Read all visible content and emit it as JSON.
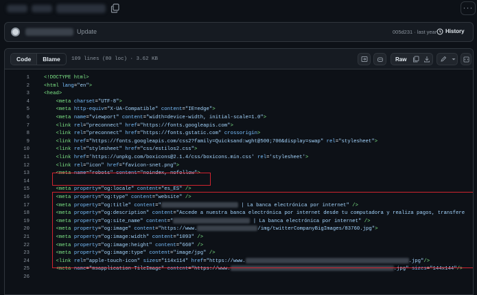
{
  "commit": {
    "message": "Update",
    "meta": "005d231 · last year",
    "history_label": "History"
  },
  "file": {
    "tab_code": "Code",
    "tab_blame": "Blame",
    "info": "109 lines (80 loc) · 3.62 KB",
    "raw_label": "Raw"
  },
  "lines": [
    {
      "n": "1",
      "html": "<span class='tg'>&lt;!DOCTYPE html&gt;</span>"
    },
    {
      "n": "2",
      "html": "<span class='tg'>&lt;html</span> <span class='at'>lang</span>=<span class='st'>\"en\"</span><span class='tg'>&gt;</span>"
    },
    {
      "n": "3",
      "html": "<span class='tg'>&lt;head&gt;</span>"
    },
    {
      "n": "4",
      "html": "    <span class='tg'>&lt;meta</span> <span class='at'>charset</span>=<span class='st'>\"UTF-8\"</span><span class='tg'>&gt;</span>"
    },
    {
      "n": "5",
      "html": "    <span class='tg'>&lt;meta</span> <span class='at'>http-equiv</span>=<span class='st'>\"X-UA-Compatible\"</span> <span class='at'>content</span>=<span class='st'>\"IE=edge\"</span><span class='tg'>&gt;</span>"
    },
    {
      "n": "6",
      "html": "    <span class='tg'>&lt;meta</span> <span class='at'>name</span>=<span class='st'>\"viewport\"</span> <span class='at'>content</span>=<span class='st'>\"width=device-width, initial-scale=1.0\"</span><span class='tg'>&gt;</span>"
    },
    {
      "n": "7",
      "html": "    <span class='tg'>&lt;link</span> <span class='at'>rel</span>=<span class='st'>\"preconnect\"</span> <span class='at'>href</span>=<span class='st'>\"https://fonts.googleapis.com\"</span><span class='tg'>&gt;</span>"
    },
    {
      "n": "8",
      "html": "    <span class='tg'>&lt;link</span> <span class='at'>rel</span>=<span class='st'>\"preconnect\"</span> <span class='at'>href</span>=<span class='st'>\"https://fonts.gstatic.com\"</span> <span class='at'>crossorigin</span><span class='tg'>&gt;</span>"
    },
    {
      "n": "9",
      "html": "    <span class='tg'>&lt;link</span> <span class='at'>href</span>=<span class='st'>\"https://fonts.googleapis.com/css2?family=Quicksand:wght@500;700&amp;display=swap\"</span> <span class='at'>rel</span>=<span class='st'>\"stylesheet\"</span><span class='tg'>&gt;</span>"
    },
    {
      "n": "10",
      "html": "    <span class='tg'>&lt;link</span> <span class='at'>rel</span>=<span class='st'>\"stylesheet\"</span> <span class='at'>href</span>=<span class='st'>\"css/estilos2.css\"</span><span class='tg'>&gt;</span>"
    },
    {
      "n": "11",
      "html": "    <span class='tg'>&lt;link</span> <span class='at'>href</span>=<span class='st'>'https://unpkg.com/boxicons@2.1.4/css/boxicons.min.css'</span> <span class='at'>rel</span>=<span class='st'>'stylesheet'</span><span class='tg'>&gt;</span>"
    },
    {
      "n": "12",
      "html": "    <span class='tg'>&lt;link</span> <span class='at'>rel</span>=<span class='st'>\"icon\"</span> <span class='at'>href</span>=<span class='st'>\"favicon-snet.png\"</span><span class='tg'>&gt;</span>"
    },
    {
      "n": "13",
      "html": "    <span class='tg'>&lt;meta</span> <span class='at'>name</span>=<span class='st'>\"robots\"</span> <span class='at'>content</span>=<span class='st'>\"noindex, nofollow\"</span><span class='tg'>&gt;</span>"
    },
    {
      "n": "14",
      "html": ""
    },
    {
      "n": "15",
      "html": "    <span class='tg'>&lt;meta</span> <span class='at'>property</span>=<span class='st'>\"og:locale\"</span> <span class='at'>content</span>=<span class='st'>\"es_ES\"</span> <span class='tg'>/&gt;</span>"
    },
    {
      "n": "16",
      "html": "    <span class='tg'>&lt;meta</span> <span class='at'>property</span>=<span class='st'>\"og:type\"</span> <span class='at'>content</span>=<span class='st'>\"website\"</span> <span class='tg'>/&gt;</span>"
    },
    {
      "n": "17",
      "html": "    <span class='tg'>&lt;meta</span> <span class='at'>property</span>=<span class='st'>\"og:title\"</span> <span class='at'>content</span>=<span class='st'>\"<span class='redact' style='width:112px'></span> | La banca electrónica por internet\"</span> <span class='tg'>/&gt;</span>"
    },
    {
      "n": "18",
      "html": "    <span class='tg'>&lt;meta</span> <span class='at'>property</span>=<span class='st'>\"og:description\"</span> <span class='at'>content</span>=<span class='st'>\"Accede a nuestra banca electrónica por internet desde tu computadora y realiza pagos, transfere</span>"
    },
    {
      "n": "19",
      "html": "    <span class='tg'>&lt;meta</span> <span class='at'>property</span>=<span class='st'>\"og:site_name\"</span> <span class='at'>content</span>=<span class='st'>\"<span class='redact' style='width:112px'></span> | La banca electrónica por internet\"</span> <span class='tg'>/&gt;</span>"
    },
    {
      "n": "20",
      "html": "    <span class='tg'>&lt;meta</span> <span class='at'>property</span>=<span class='st'>\"og:image\"</span> <span class='at'>content</span>=<span class='st'>\"https://www.<span class='redact' style='width:88px'></span>/img/twitterCompanyBigImages/83760.jpg\"</span><span class='tg'>&gt;</span>"
    },
    {
      "n": "21",
      "html": "    <span class='tg'>&lt;meta</span> <span class='at'>property</span>=<span class='st'>\"og:image:width\"</span> <span class='at'>content</span>=<span class='st'>\"1093\"</span> <span class='tg'>/&gt;</span>"
    },
    {
      "n": "22",
      "html": "    <span class='tg'>&lt;meta</span> <span class='at'>property</span>=<span class='st'>\"og:image:height\"</span> <span class='at'>content</span>=<span class='st'>\"660\"</span> <span class='tg'>/&gt;</span>"
    },
    {
      "n": "23",
      "html": "    <span class='tg'>&lt;meta</span> <span class='at'>property</span>=<span class='st'>\"og:image:type\"</span> <span class='at'>content</span>=<span class='st'>\"image/jpg\"</span> <span class='tg'>/&gt;</span>"
    },
    {
      "n": "24",
      "html": "    <span class='tg'>&lt;link</span> <span class='at'>rel</span>=<span class='st'>\"apple-touch-icon\"</span> <span class='at'>sizes</span>=<span class='st'>\"114x114\"</span> <span class='at'>href</span>=<span class='st'>\"https://www.<span class='redact' style='width:238px'></span>.jpg\"</span><span class='tg'>/&gt;</span>"
    },
    {
      "n": "25",
      "html": "    <span class='tg'>&lt;meta</span> <span class='at'>name</span>=<span class='st'>\"msapplication-TileImage\"</span> <span class='at'>content</span>=<span class='st'>\"https://www.<span class='redact' style='width:238px'></span>.jpg\"</span> <span class='at'>sizes</span>=<span class='st'>\"144x144\"</span><span class='tg'>/&gt;</span>"
    },
    {
      "n": "26",
      "html": ""
    }
  ],
  "colors": {
    "background": "#0d1117",
    "panel": "#161b22",
    "border": "#30363d",
    "tag": "#7ee787",
    "attr": "#79c0ff",
    "string": "#a5d6ff",
    "highlight_box": "#d1242f"
  },
  "icons": [
    "copy-icon",
    "kebab-menu-icon",
    "history-icon",
    "symbols-icon",
    "copilot-icon",
    "copy-raw-icon",
    "download-icon",
    "edit-pencil-icon",
    "chevron-down-icon",
    "symbols-panel-icon"
  ]
}
